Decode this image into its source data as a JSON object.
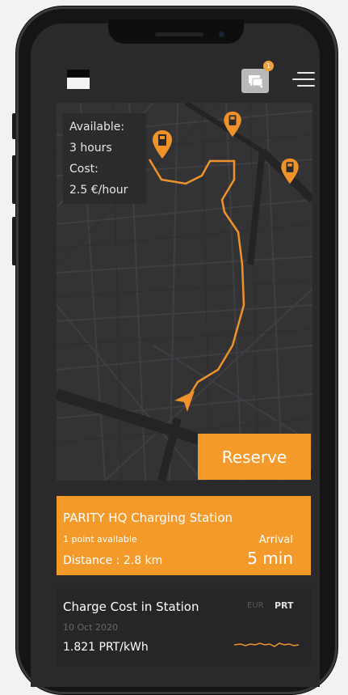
{
  "header": {
    "notification_count": "1"
  },
  "info_box": {
    "available_label": "Available:",
    "available_value": "3 hours",
    "cost_label": "Cost:",
    "cost_value": "2.5 €/hour"
  },
  "reserve_button": {
    "label": "Reserve"
  },
  "station": {
    "name": "PARITY HQ Charging Station",
    "points": "1 point available",
    "distance": "Distance : 2.8 km",
    "arrival_label": "Arrival",
    "arrival_value": "5 min"
  },
  "charge_cost": {
    "title": "Charge Cost in Station",
    "date": "10 Oct 2020",
    "rate": "1.821 PRT/kWh",
    "currencies": [
      "EUR",
      "PRT"
    ],
    "selected_currency": "PRT"
  },
  "colors": {
    "accent": "#f39a2b",
    "map_bg": "#333336",
    "panel_bg": "#262628"
  }
}
